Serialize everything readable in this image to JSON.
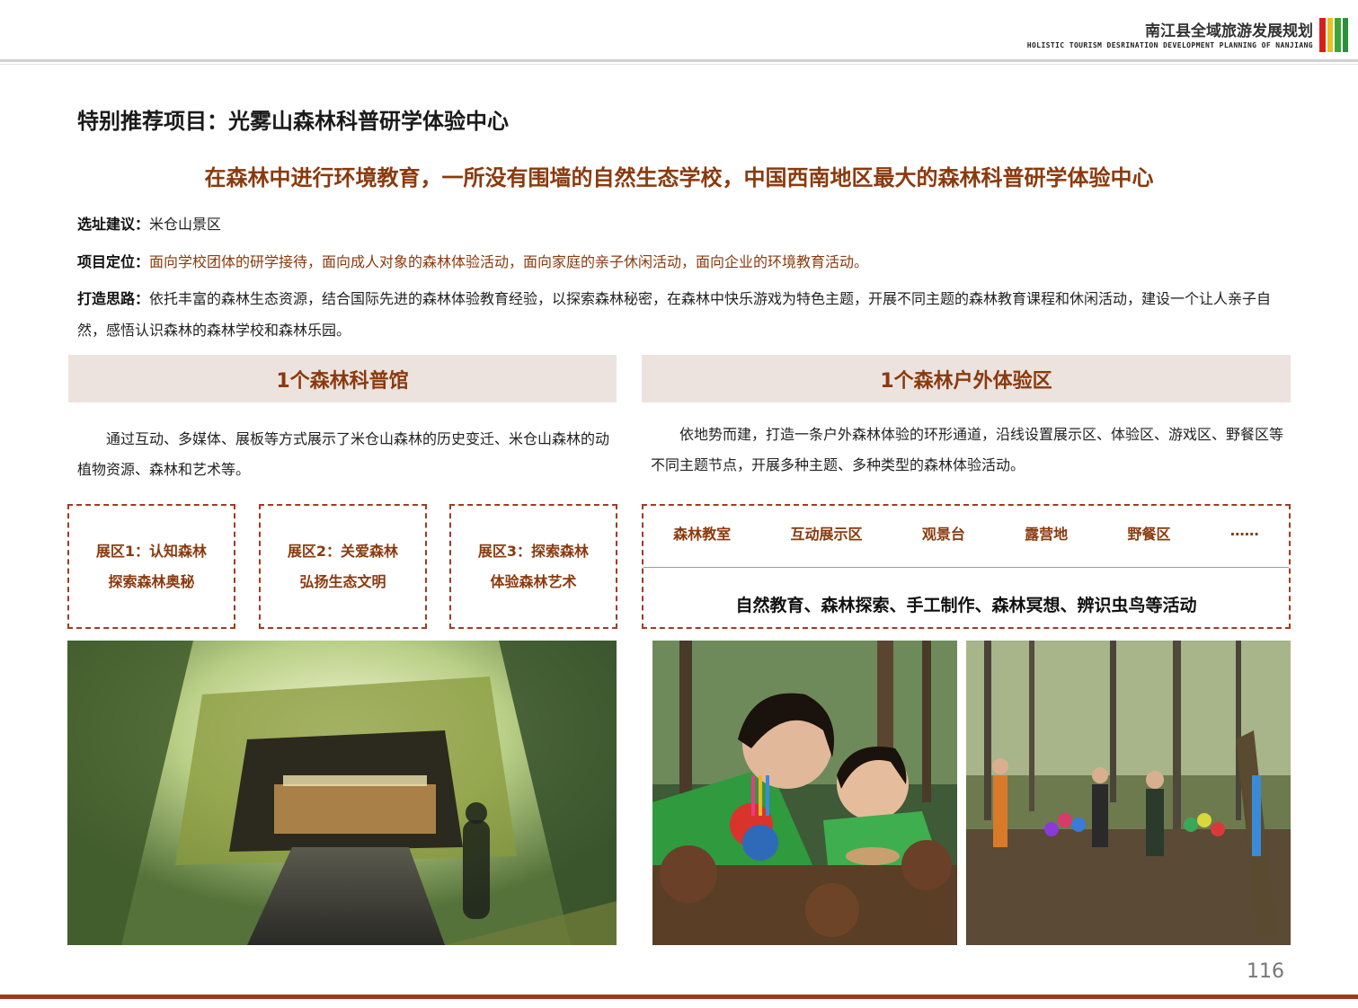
{
  "header": {
    "title": "南江县全域旅游发展规划",
    "subtitle": "HOLISTIC TOURISM DESRINATION DEVELOPMENT PLANNING OF NANJIANG",
    "bar_colors": [
      "#d6201e",
      "#e8c21e",
      "#3aa63a",
      "#2c8f3a"
    ]
  },
  "page": {
    "title": "特别推荐项目：光雾山森林科普研学体验中心",
    "slogan": "在森林中进行环境教育，一所没有围墙的自然生态学校，中国西南地区最大的森林科普研学体验中心"
  },
  "info": {
    "site": {
      "label": "选址建议：",
      "text": "米仓山景区"
    },
    "position": {
      "label": "项目定位：",
      "text": "面向学校团体的研学接待，面向成人对象的森林体验活动，面向家庭的亲子休闲活动，面向企业的环境教育活动。"
    },
    "idea": {
      "label": "打造思路：",
      "text": "依托丰富的森林生态资源，结合国际先进的森林体验教育经验，以探索森林秘密，在森林中快乐游戏为特色主题，开展不同主题的森林教育课程和休闲活动，建设一个让人亲子自然，感悟认识森林的森林学校和森林乐园。"
    }
  },
  "left": {
    "band": "1个森林科普馆",
    "desc": "通过互动、多媒体、展板等方式展示了米仓山森林的历史变迁、米仓山森林的动植物资源、森林和艺术等。",
    "zones": [
      {
        "line1": "展区1：认知森林",
        "line2": "探索森林奥秘"
      },
      {
        "line1": "展区2：关爱森林",
        "line2": "弘扬生态文明"
      },
      {
        "line1": "展区3：探索森林",
        "line2": "体验森林艺术"
      }
    ]
  },
  "right": {
    "band": "1个森林户外体验区",
    "desc": "依地势而建，打造一条户外森林体验的环形通道，沿线设置展示区、体验区、游戏区、野餐区等不同主题节点，开展多种主题、多种类型的森林体验活动。",
    "items": [
      "森林教室",
      "互动展示区",
      "观景台",
      "露营地",
      "野餐区",
      "……"
    ],
    "activities": "自然教育、森林探索、手工制作、森林冥想、辨识虫鸟等活动"
  },
  "page_number": "116",
  "colors": {
    "accent": "#8a3a0e",
    "band": "#ece3df",
    "dash": "#a33a24",
    "footer": "#9e3a1c"
  }
}
